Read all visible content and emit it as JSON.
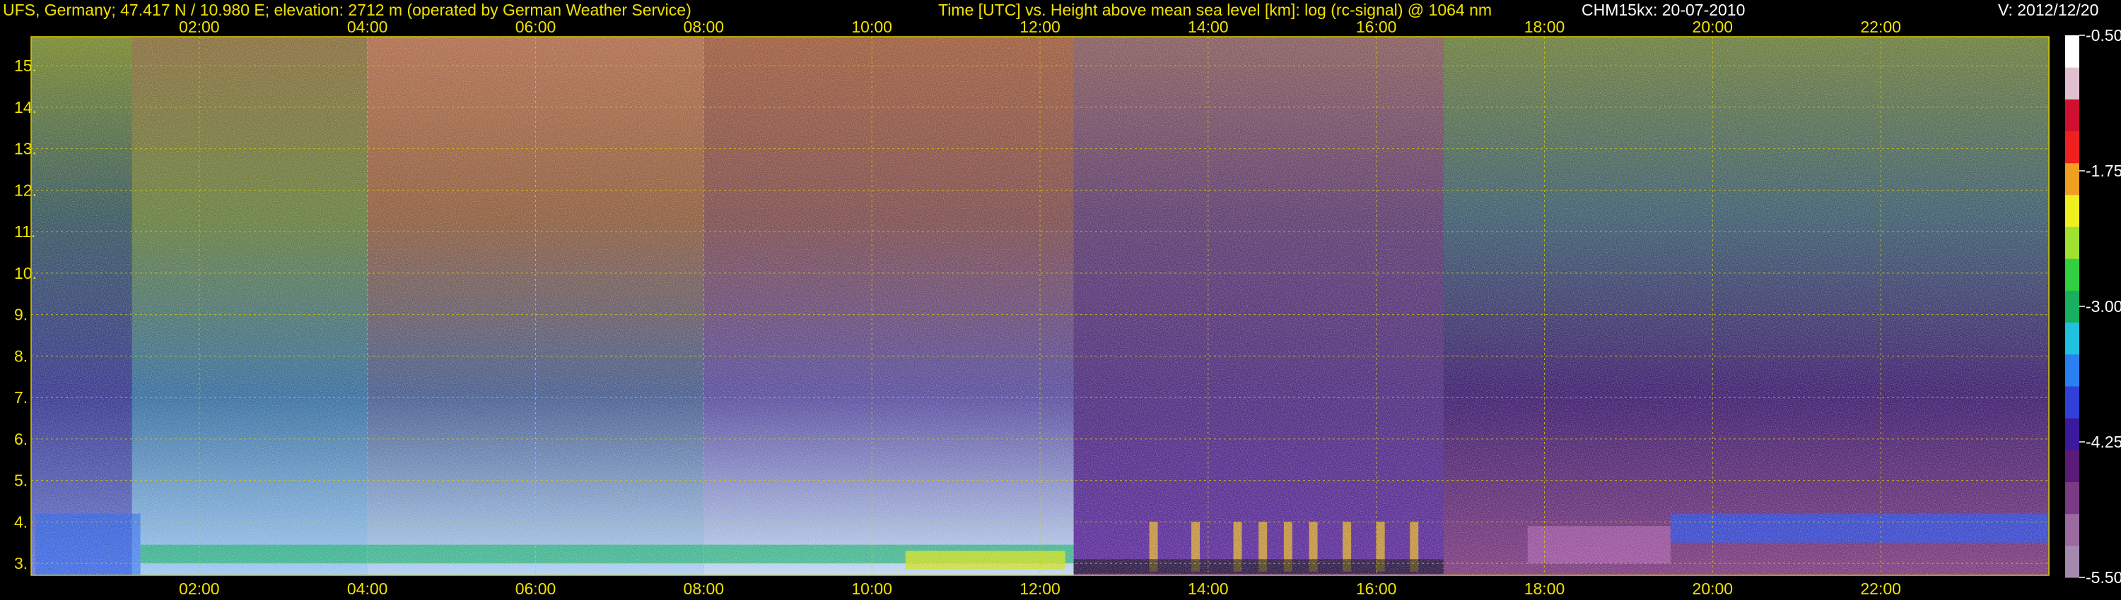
{
  "header": {
    "station": "UFS, Germany; 47.417 N / 10.980 E; elevation: 2712 m  (operated by German Weather Service)",
    "axes_title": "Time [UTC] vs. Height above mean sea level [km]: log (rc-signal) @ 1064 nm",
    "instrument_date": "CHM15kx: 20-07-2010",
    "version": "V: 2012/12/20"
  },
  "colors": {
    "text": "#f2e200",
    "grid": "#d8cc00",
    "background": "#000000",
    "colorbar": [
      "#a58ab0",
      "#9a6aa0",
      "#7a3a86",
      "#5a1a78",
      "#3a1a9a",
      "#3040d8",
      "#2a80f0",
      "#20c0e0",
      "#18b060",
      "#30d040",
      "#a0e030",
      "#f0f020",
      "#f0a020",
      "#f02020",
      "#d01030",
      "#e0c0d0",
      "#ffffff"
    ]
  },
  "chart_data": {
    "type": "heatmap",
    "title": "Time [UTC] vs. Height above mean sea level [km]: log (rc-signal) @ 1064 nm",
    "xlabel": "Time [UTC]",
    "ylabel": "Height above mean sea level [km]",
    "x_range_hours": [
      0.0,
      24.0
    ],
    "y_range_km": [
      2.712,
      15.7
    ],
    "x_ticks": [
      "02:00",
      "04:00",
      "06:00",
      "08:00",
      "10:00",
      "12:00",
      "14:00",
      "16:00",
      "18:00",
      "20:00",
      "22:00"
    ],
    "x_tick_hours": [
      2,
      4,
      6,
      8,
      10,
      12,
      14,
      16,
      18,
      20,
      22
    ],
    "y_ticks": [
      "3.",
      "4.",
      "5.",
      "6.",
      "7.",
      "8.",
      "9.",
      "10.",
      "11.",
      "12.",
      "13.",
      "14.",
      "15."
    ],
    "y_tick_km": [
      3,
      4,
      5,
      6,
      7,
      8,
      9,
      10,
      11,
      12,
      13,
      14,
      15
    ],
    "colorbar": {
      "labels": [
        "-0.50",
        "-1.75",
        "-3.00",
        "-4.25",
        "-5.50"
      ],
      "values": [
        -0.5,
        -1.75,
        -3.0,
        -4.25,
        -5.5
      ],
      "range": [
        -5.5,
        -0.5
      ]
    },
    "grid": true
  }
}
